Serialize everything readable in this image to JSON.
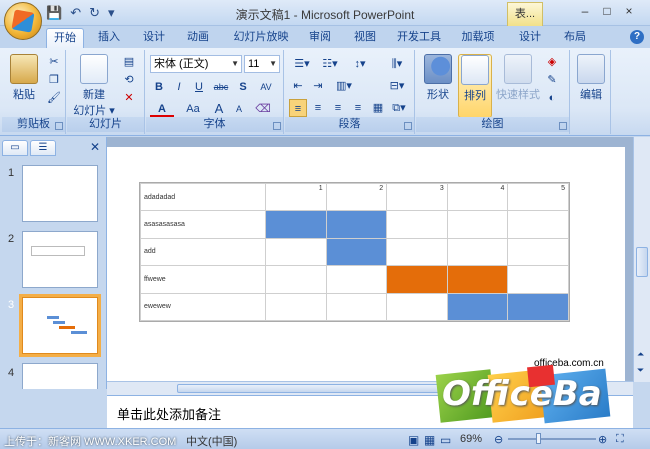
{
  "window": {
    "title": "演示文稿1 - Microsoft PowerPoint",
    "context_tab": "表...",
    "controls": [
      "–",
      "□",
      "×"
    ]
  },
  "ribbon_tabs": [
    "开始",
    "插入",
    "设计",
    "动画",
    "幻灯片放映",
    "审阅",
    "视图",
    "开发工具",
    "加载项",
    "设计",
    "布局"
  ],
  "help": "?",
  "ribbon": {
    "clipboard": {
      "label": "剪贴板",
      "paste": "粘贴"
    },
    "slides": {
      "label": "幻灯片",
      "new_slide_1": "新建",
      "new_slide_2": "幻灯片 ▾"
    },
    "font": {
      "label": "字体",
      "font_name": "宋体 (正文)",
      "font_size": "11",
      "bold": "B",
      "italic": "I",
      "underline": "U",
      "strike": "abc",
      "shadow": "S",
      "spacing": "AV",
      "color": "A",
      "case": "Aa",
      "grow": "A",
      "shrink": "A"
    },
    "paragraph": {
      "label": "段落"
    },
    "drawing": {
      "label": "绘图",
      "shape": "形状",
      "arrange": "排列",
      "quick_styles": "快速样式"
    },
    "editing": {
      "label": "编辑"
    }
  },
  "slide_panel": {
    "slides": [
      {
        "num": "1"
      },
      {
        "num": "2"
      },
      {
        "num": "3"
      },
      {
        "num": "4"
      }
    ]
  },
  "table": {
    "header": [
      "adadadad",
      "1",
      "2",
      "3",
      "4",
      "5"
    ],
    "rows": [
      {
        "label": "asasasasasa"
      },
      {
        "label": "add"
      },
      {
        "label": "ffwewe"
      },
      {
        "label": "ewewew"
      }
    ],
    "colors": {
      "blue": "#5b8fd6",
      "orange": "#e46d0a"
    }
  },
  "notes": {
    "placeholder": "单击此处添加备注"
  },
  "status": {
    "language": "中文(中国)",
    "zoom": "69%",
    "upload": "上传于：新客网 WWW.XKER.COM"
  },
  "watermark": {
    "url": "officeba.com.cn",
    "logo": "OfficeBa"
  }
}
